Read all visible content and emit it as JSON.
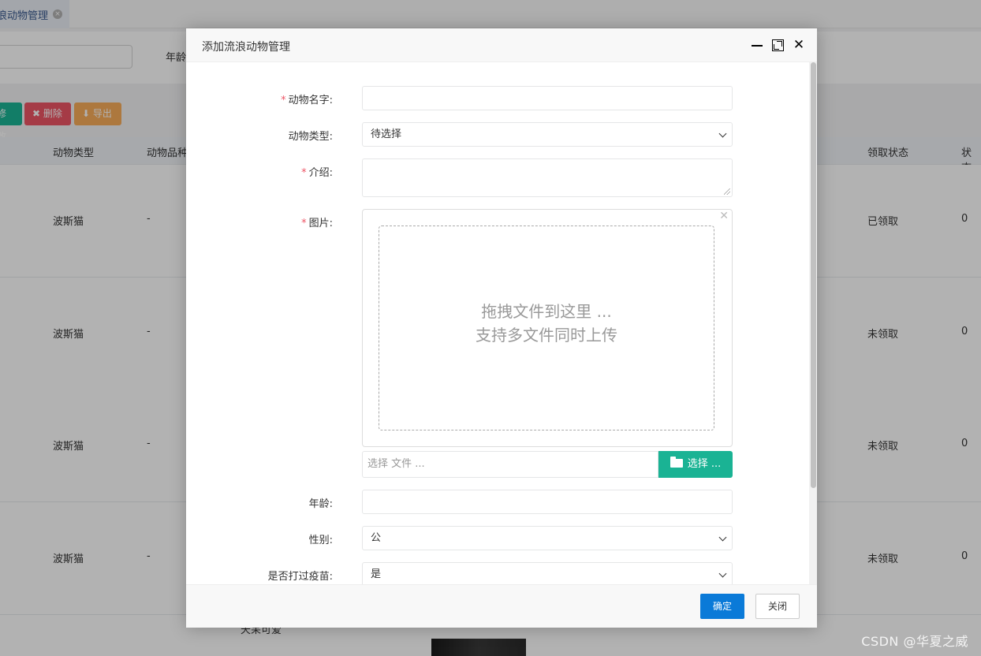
{
  "background": {
    "tab": {
      "label": "浪动物管理",
      "close_icon": "close-circle-icon"
    },
    "search": {
      "age_label": "年龄"
    },
    "toolbar": {
      "edit_label": "修改",
      "delete_label": "✖ 删除",
      "export_label": "⬇ 导出"
    },
    "table": {
      "headers": [
        "动物类型",
        "动物品种",
        "领取状态",
        "状态"
      ],
      "rows": [
        {
          "type": "波斯猫",
          "breed": "-",
          "claim_status": "已领取",
          "status": "0"
        },
        {
          "type": "波斯猫",
          "breed": "-",
          "claim_status": "未领取",
          "status": "0"
        },
        {
          "type": "波斯猫",
          "breed": "-",
          "claim_status": "未领取",
          "status": "0"
        },
        {
          "type": "波斯猫",
          "breed": "-",
          "claim_status": "未领取",
          "status": "0"
        }
      ],
      "partial_text": "天呆可爱"
    }
  },
  "modal": {
    "title": "添加流浪动物管理",
    "form": {
      "name_label": "动物名字:",
      "type_label": "动物类型:",
      "type_value": "待选择",
      "intro_label": "介绍:",
      "image_label": "图片:",
      "drop_line1": "拖拽文件到这里 ...",
      "drop_line2": "支持多文件同时上传",
      "file_caption_placeholder": "选择 文件 ...",
      "file_button": "选择 ...",
      "age_label": "年龄:",
      "gender_label": "性别:",
      "gender_value": "公",
      "vaccine_label": "是否打过疫苗:",
      "vaccine_value": "是",
      "required_mark": "*"
    },
    "footer": {
      "confirm": "确定",
      "close": "关闭"
    }
  },
  "watermark": "CSDN @华夏之威"
}
